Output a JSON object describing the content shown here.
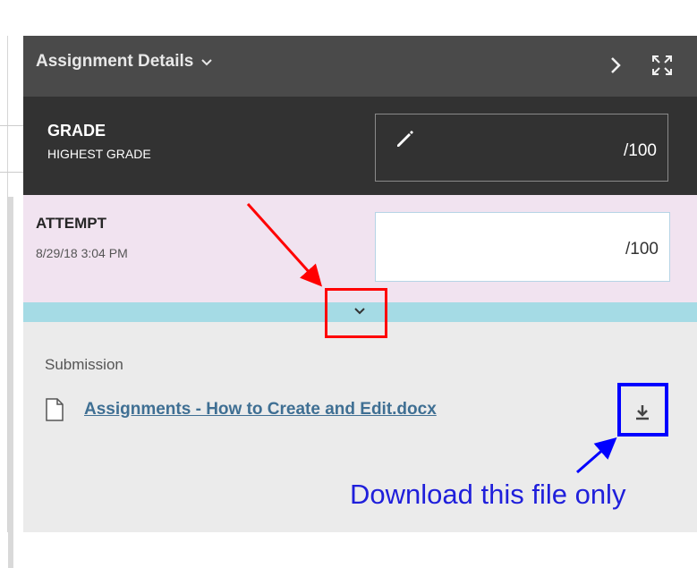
{
  "header": {
    "title": "Assignment Details",
    "next_icon": "chevron-right-icon",
    "expand_icon": "expand-icon"
  },
  "grade": {
    "label": "GRADE",
    "sublabel": "HIGHEST GRADE",
    "value": "/100",
    "icon": "pencil-icon"
  },
  "attempt": {
    "label": "ATTEMPT",
    "date": "8/29/18 3:04 PM",
    "value": "/100"
  },
  "submission": {
    "label": "Submission",
    "file_name": "Assignments - How to Create and Edit.docx",
    "file_icon": "document-icon",
    "download_icon": "download-icon"
  },
  "annotation": {
    "caption": "Download this file only",
    "colors": {
      "red": "#ff0000",
      "blue": "#0000ff"
    }
  },
  "colors": {
    "header_bg": "#4a4a4a",
    "grade_bg": "#323232",
    "attempt_bg": "#f1e3f0",
    "collapse_bar": "#a5dbe5",
    "panel_bg": "#ebebeb",
    "link": "#3f6f93"
  }
}
